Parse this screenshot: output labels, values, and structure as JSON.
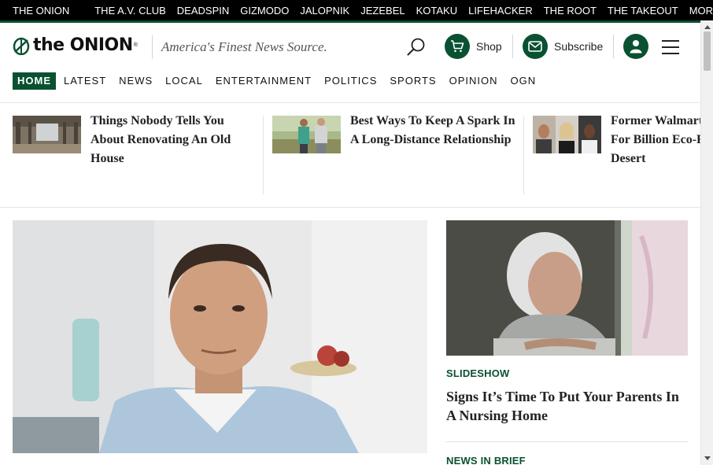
{
  "network": {
    "items": [
      "THE ONION",
      "THE A.V. CLUB",
      "DEADSPIN",
      "GIZMODO",
      "JALOPNIK",
      "JEZEBEL",
      "KOTAKU",
      "LIFEHACKER",
      "THE ROOT",
      "THE TAKEOUT"
    ],
    "more_label": "MORE"
  },
  "header": {
    "logo_text": "the ONION",
    "logo_mark": "®",
    "tagline": "America's Finest News Source.",
    "shop_label": "Shop",
    "subscribe_label": "Subscribe"
  },
  "nav": {
    "items": [
      "HOME",
      "LATEST",
      "NEWS",
      "LOCAL",
      "ENTERTAINMENT",
      "POLITICS",
      "SPORTS",
      "OPINION",
      "OGN"
    ]
  },
  "trending": [
    {
      "title": "Things Nobody Tells You About Renovating An Old House"
    },
    {
      "title": "Best Ways To Keep A Spark In A Long-Distance Relationship"
    },
    {
      "title": "Former Walmart Unveils Plan For Billion Eco-Friendly Desert"
    }
  ],
  "main": {
    "side_kicker": "SLIDESHOW",
    "side_headline": "Signs It’s Time To Put Your Parents In A Nursing Home",
    "next_kicker": "NEWS IN BRIEF"
  },
  "colors": {
    "brand_green": "#0a5132",
    "network_bar": "#000000"
  }
}
